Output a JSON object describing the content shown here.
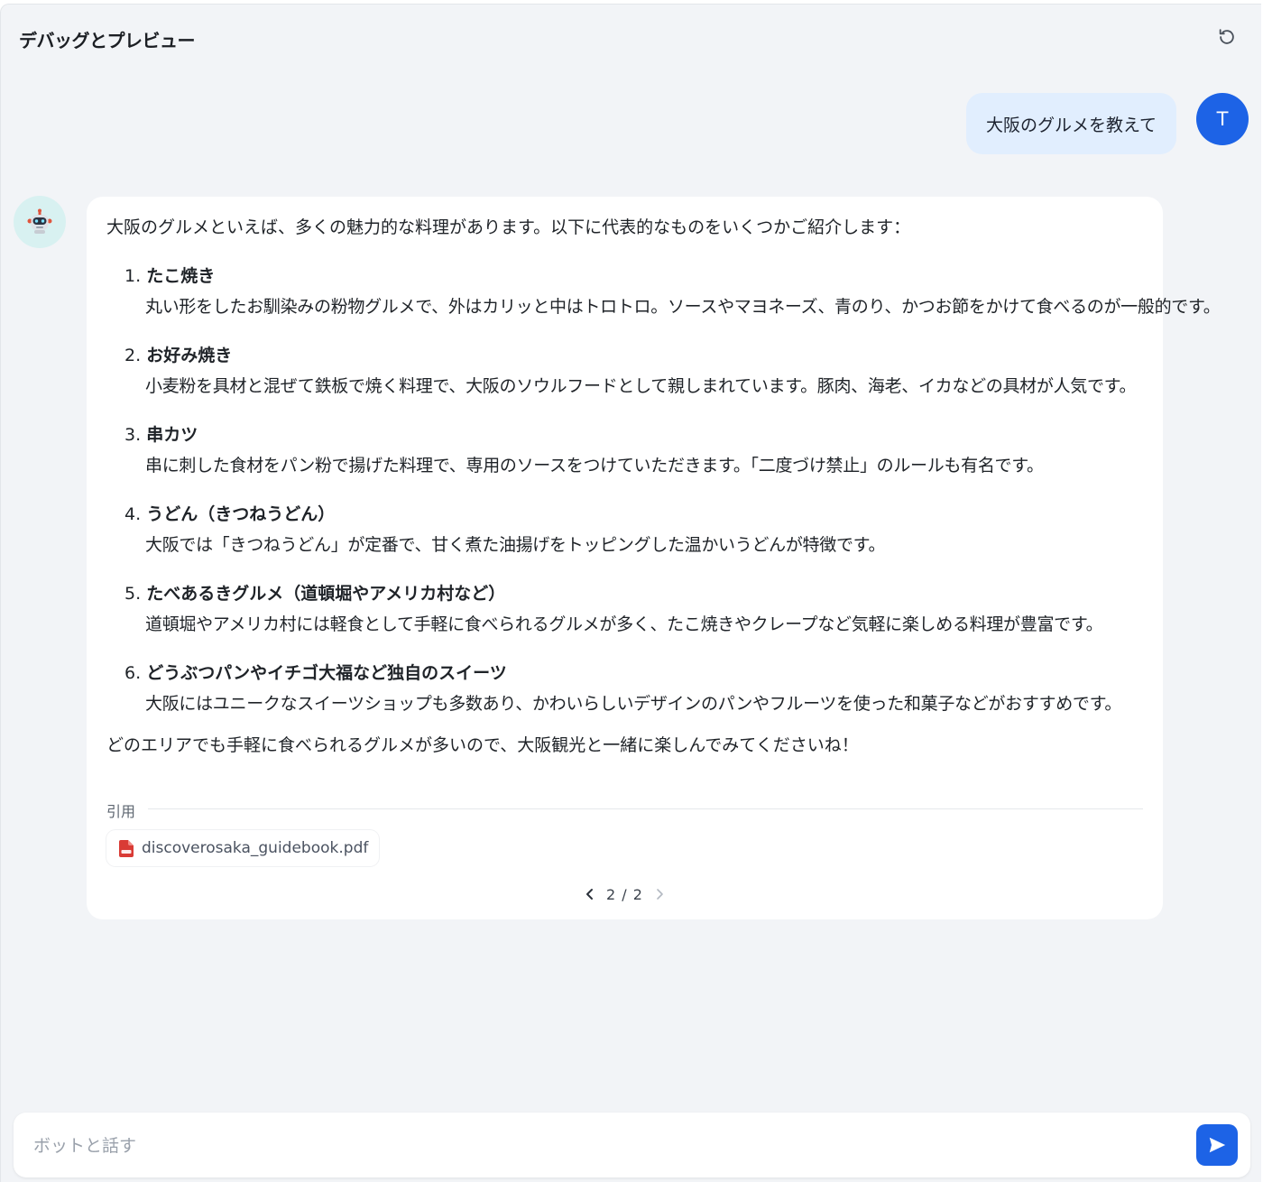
{
  "header": {
    "title": "デバッグとプレビュー",
    "reset_icon": "refresh-icon"
  },
  "user_message": {
    "text": "大阪のグルメを教えて",
    "avatar_initial": "T"
  },
  "bot_message": {
    "avatar_icon": "robot-icon",
    "intro": "大阪のグルメといえば、多くの魅力的な料理があります。以下に代表的なものをいくつかご紹介します：",
    "items": [
      {
        "num": "1.",
        "title": "たこ焼き",
        "desc": "丸い形をしたお馴染みの粉物グルメで、外はカリッと中はトロトロ。ソースやマヨネーズ、青のり、かつお節をかけて食べるのが一般的です。"
      },
      {
        "num": "2.",
        "title": "お好み焼き",
        "desc": "小麦粉を具材と混ぜて鉄板で焼く料理で、大阪のソウルフードとして親しまれています。豚肉、海老、イカなどの具材が人気です。"
      },
      {
        "num": "3.",
        "title": "串カツ",
        "desc": "串に刺した食材をパン粉で揚げた料理で、専用のソースをつけていただきます。「二度づけ禁止」のルールも有名です。"
      },
      {
        "num": "4.",
        "title": "うどん（きつねうどん）",
        "desc": "大阪では「きつねうどん」が定番で、甘く煮た油揚げをトッピングした温かいうどんが特徴です。"
      },
      {
        "num": "5.",
        "title": "たべあるきグルメ（道頓堀やアメリカ村など）",
        "desc": "道頓堀やアメリカ村には軽食として手軽に食べられるグルメが多く、たこ焼きやクレープなど気軽に楽しめる料理が豊富です。"
      },
      {
        "num": "6.",
        "title": "どうぶつパンやイチゴ大福など独自のスイーツ",
        "desc": "大阪にはユニークなスイーツショップも多数あり、かわいらしいデザインのパンやフルーツを使った和菓子などがおすすめです。"
      }
    ],
    "outro": "どのエリアでも手軽に食べられるグルメが多いので、大阪観光と一緒に楽しんでみてくださいね！",
    "citation_label": "引用",
    "citation_file": "discoverosaka_guidebook.pdf",
    "citation_icon": "pdf-file-icon",
    "pager": "2 / 2"
  },
  "composer": {
    "placeholder": "ボットと話す",
    "value": "",
    "send_icon": "send-icon"
  },
  "colors": {
    "accent": "#1d63e6",
    "user_bubble": "#e1eefe",
    "bot_avatar_bg": "#d8f1f1",
    "panel_bg": "#f2f4f7",
    "pdf_red": "#d93b35"
  }
}
